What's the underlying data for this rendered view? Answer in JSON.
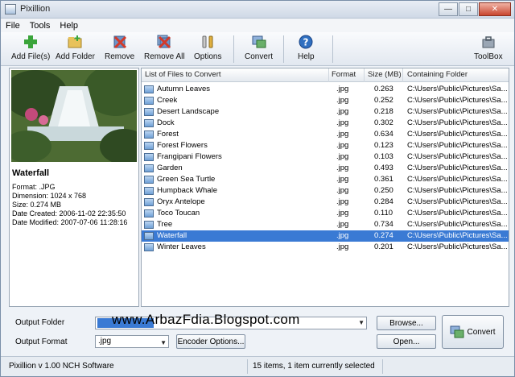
{
  "window": {
    "title": "Pixillion"
  },
  "menu": [
    "File",
    "Tools",
    "Help"
  ],
  "toolbar": {
    "add_files": "Add File(s)",
    "add_folder": "Add Folder",
    "remove": "Remove",
    "remove_all": "Remove All",
    "options": "Options",
    "convert": "Convert",
    "help": "Help",
    "toolbox": "ToolBox"
  },
  "preview": {
    "title": "Waterfall",
    "format": "Format: .JPG",
    "dimension": "Dimension: 1024 x 768",
    "size": "Size: 0.274 MB",
    "created": "Date Created: 2006-11-02 22:35:50",
    "modified": "Date Modified: 2007-07-06 11:28:16"
  },
  "filelist": {
    "headers": {
      "name": "List of Files to Convert",
      "format": "Format",
      "size": "Size (MB)",
      "folder": "Containing Folder"
    },
    "rows": [
      {
        "name": "Autumn Leaves",
        "format": ".jpg",
        "size": "0.263",
        "folder": "C:\\Users\\Public\\Pictures\\Sa..."
      },
      {
        "name": "Creek",
        "format": ".jpg",
        "size": "0.252",
        "folder": "C:\\Users\\Public\\Pictures\\Sa..."
      },
      {
        "name": "Desert Landscape",
        "format": ".jpg",
        "size": "0.218",
        "folder": "C:\\Users\\Public\\Pictures\\Sa..."
      },
      {
        "name": "Dock",
        "format": ".jpg",
        "size": "0.302",
        "folder": "C:\\Users\\Public\\Pictures\\Sa..."
      },
      {
        "name": "Forest",
        "format": ".jpg",
        "size": "0.634",
        "folder": "C:\\Users\\Public\\Pictures\\Sa..."
      },
      {
        "name": "Forest Flowers",
        "format": ".jpg",
        "size": "0.123",
        "folder": "C:\\Users\\Public\\Pictures\\Sa..."
      },
      {
        "name": "Frangipani Flowers",
        "format": ".jpg",
        "size": "0.103",
        "folder": "C:\\Users\\Public\\Pictures\\Sa..."
      },
      {
        "name": "Garden",
        "format": ".jpg",
        "size": "0.493",
        "folder": "C:\\Users\\Public\\Pictures\\Sa..."
      },
      {
        "name": "Green Sea Turtle",
        "format": ".jpg",
        "size": "0.361",
        "folder": "C:\\Users\\Public\\Pictures\\Sa..."
      },
      {
        "name": "Humpback Whale",
        "format": ".jpg",
        "size": "0.250",
        "folder": "C:\\Users\\Public\\Pictures\\Sa..."
      },
      {
        "name": "Oryx Antelope",
        "format": ".jpg",
        "size": "0.284",
        "folder": "C:\\Users\\Public\\Pictures\\Sa..."
      },
      {
        "name": "Toco Toucan",
        "format": ".jpg",
        "size": "0.110",
        "folder": "C:\\Users\\Public\\Pictures\\Sa..."
      },
      {
        "name": "Tree",
        "format": ".jpg",
        "size": "0.734",
        "folder": "C:\\Users\\Public\\Pictures\\Sa..."
      },
      {
        "name": "Waterfall",
        "format": ".jpg",
        "size": "0.274",
        "folder": "C:\\Users\\Public\\Pictures\\Sa...",
        "selected": true
      },
      {
        "name": "Winter Leaves",
        "format": ".jpg",
        "size": "0.201",
        "folder": "C:\\Users\\Public\\Pictures\\Sa..."
      }
    ]
  },
  "bottom": {
    "output_folder_label": "Output Folder",
    "output_format_label": "Output Format",
    "output_format_value": ".jpg",
    "watermark": "www.ArbazFdia.Blogspot.com",
    "browse": "Browse...",
    "encoder_options": "Encoder Options...",
    "open": "Open...",
    "convert": "Convert"
  },
  "status": {
    "version": "Pixillion v 1.00  NCH Software",
    "selection": "15 items, 1 item currently selected"
  },
  "colors": {
    "selection": "#3a7ad4",
    "accent": "#2f6fc0"
  }
}
